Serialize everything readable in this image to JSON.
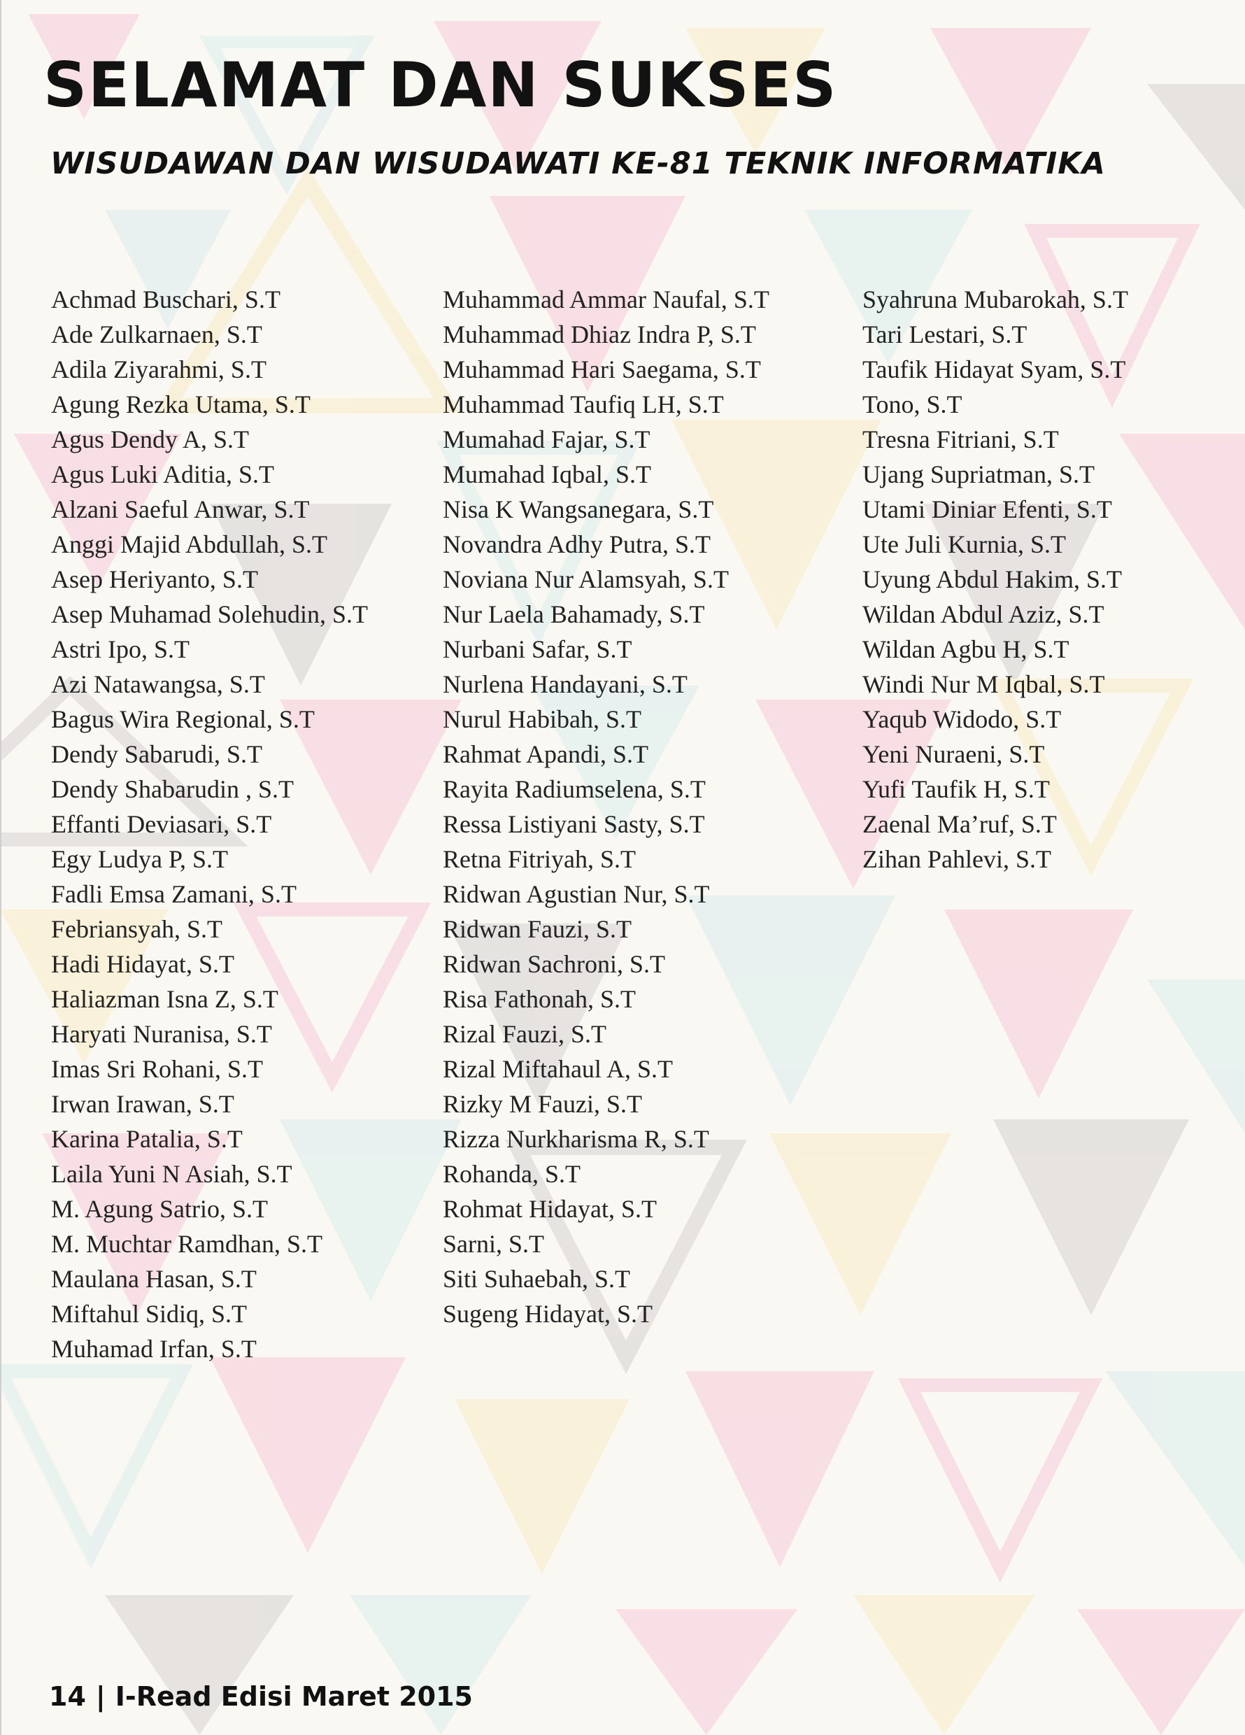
{
  "header": {
    "title": "SELAMAT DAN SUKSES",
    "subtitle": "WISUDAWAN DAN WISUDAWATI KE-81 TEKNIK INFORMATIKA"
  },
  "colors": {
    "background": "#f9f6f1",
    "pink": "#f2a9c4",
    "yellow": "#f6e0a0",
    "cyan": "#bfe3e6",
    "gray": "#b9b7b8",
    "text": "#121212"
  },
  "graduates": {
    "column1": [
      "Achmad Buschari, S.T",
      "Ade Zulkarnaen, S.T",
      "Adila Ziyarahmi, S.T",
      "Agung Rezka Utama, S.T",
      "Agus Dendy A, S.T",
      "Agus Luki Aditia, S.T",
      "Alzani Saeful Anwar, S.T",
      "Anggi Majid Abdullah, S.T",
      "Asep Heriyanto, S.T",
      "Asep Muhamad Solehudin, S.T",
      "Astri Ipo, S.T",
      "Azi Natawangsa, S.T",
      "Bagus Wira Regional, S.T",
      "Dendy Sabarudi, S.T",
      "Dendy Shabarudin , S.T",
      "Effanti Deviasari, S.T",
      "Egy Ludya P, S.T",
      "Fadli Emsa Zamani, S.T",
      "Febriansyah, S.T",
      "Hadi Hidayat, S.T",
      "Haliazman Isna Z, S.T",
      "Haryati Nuranisa, S.T",
      "Imas Sri Rohani, S.T",
      "Irwan Irawan, S.T",
      "Karina Patalia, S.T",
      "Laila Yuni N Asiah, S.T",
      "M. Agung Satrio, S.T",
      "M. Muchtar Ramdhan, S.T",
      "Maulana Hasan, S.T",
      "Miftahul Sidiq, S.T",
      "Muhamad Irfan, S.T"
    ],
    "column2": [
      "Muhammad Ammar Naufal, S.T",
      "Muhammad Dhiaz Indra P, S.T",
      "Muhammad Hari Saegama, S.T",
      "Muhammad Taufiq LH, S.T",
      "Mumahad Fajar, S.T",
      "Mumahad Iqbal, S.T",
      "Nisa K Wangsanegara, S.T",
      "Novandra Adhy Putra, S.T",
      "Noviana Nur Alamsyah, S.T",
      "Nur Laela Bahamady, S.T",
      "Nurbani Safar, S.T",
      "Nurlena Handayani, S.T",
      "Nurul Habibah, S.T",
      "Rahmat Apandi, S.T",
      "Rayita Radiumselena, S.T",
      "Ressa Listiyani Sasty, S.T",
      "Retna Fitriyah, S.T",
      "Ridwan Agustian Nur, S.T",
      "Ridwan Fauzi, S.T",
      "Ridwan Sachroni, S.T",
      "Risa Fathonah, S.T",
      "Rizal Fauzi, S.T",
      "Rizal Miftahaul A, S.T",
      "Rizky M Fauzi, S.T",
      "Rizza Nurkharisma R, S.T",
      "Rohanda, S.T",
      "Rohmat Hidayat, S.T",
      "Sarni, S.T",
      "Siti Suhaebah, S.T",
      "Sugeng Hidayat, S.T"
    ],
    "column3": [
      "Syahruna Mubarokah, S.T",
      "Tari Lestari, S.T",
      "Taufik Hidayat Syam, S.T",
      "Tono, S.T",
      "Tresna Fitriani, S.T",
      "Ujang Supriatman, S.T",
      "Utami Diniar Efenti, S.T",
      "Ute Juli Kurnia, S.T",
      "Uyung Abdul Hakim, S.T",
      "Wildan Abdul Aziz, S.T",
      "Wildan Agbu H, S.T",
      "Windi Nur M Iqbal, S.T",
      "Yaqub Widodo, S.T",
      "Yeni Nuraeni, S.T",
      "Yufi Taufik H, S.T",
      "Zaenal Ma’ruf, S.T",
      "Zihan Pahlevi, S.T"
    ]
  },
  "footer": {
    "page_number": "14",
    "separator": "|",
    "publication": "I-Read Edisi Maret 2015"
  }
}
